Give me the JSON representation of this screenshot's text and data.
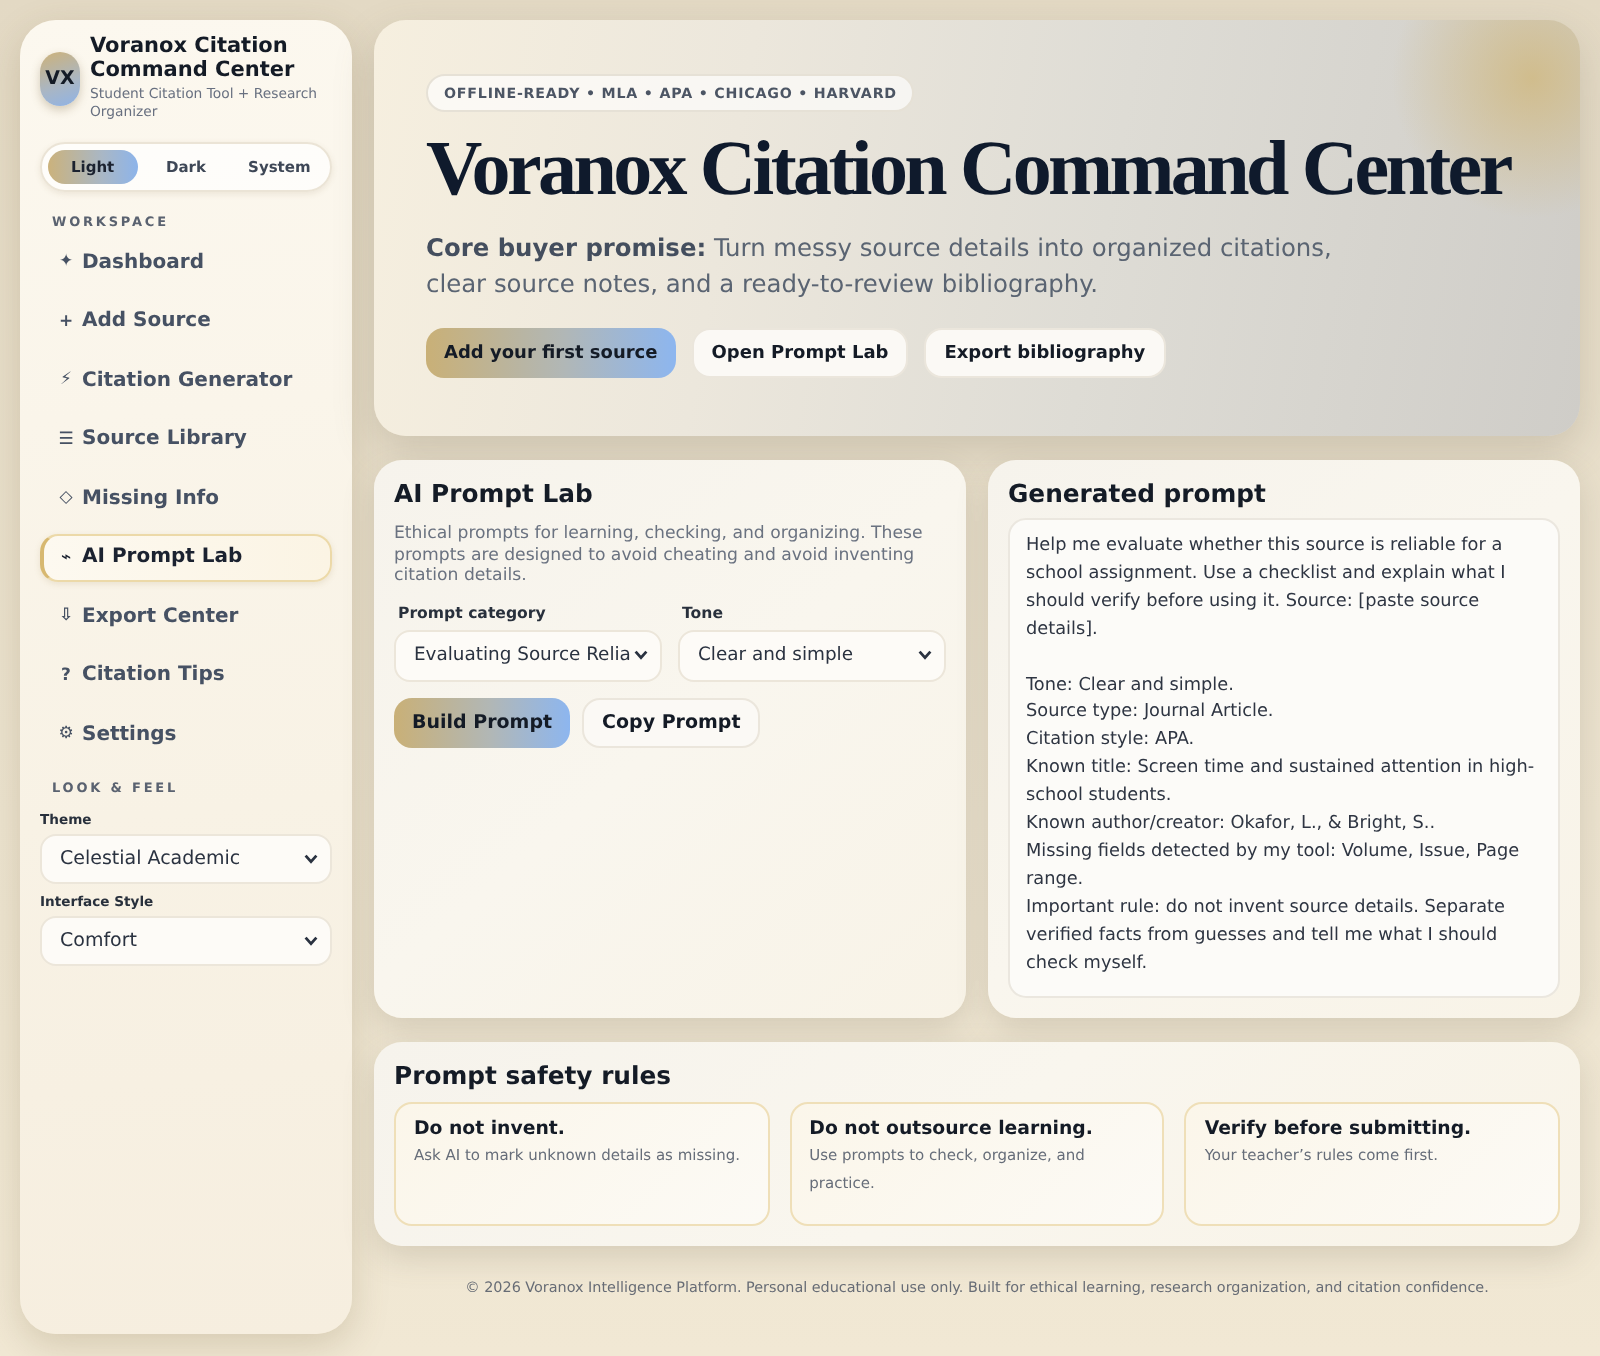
{
  "sidebar": {
    "brand": {
      "logo": "VX",
      "title": "Voranox Citation Command Center",
      "subtitle": "Student Citation Tool + Research Organizer"
    },
    "mode_switch": [
      {
        "label": "Light",
        "selected": true
      },
      {
        "label": "Dark",
        "selected": false
      },
      {
        "label": "System",
        "selected": false
      }
    ],
    "nav_heading": "WORKSPACE",
    "nav_items": [
      {
        "icon": "✦",
        "label": "Dashboard",
        "selected": false
      },
      {
        "icon": "+",
        "label": "Add Source",
        "selected": false
      },
      {
        "icon": "⚡",
        "label": "Citation Generator",
        "selected": false
      },
      {
        "icon": "☰",
        "label": "Source Library",
        "selected": false
      },
      {
        "icon": "◇",
        "label": "Missing Info",
        "selected": false
      },
      {
        "icon": "⌁",
        "label": "AI Prompt Lab",
        "selected": true
      },
      {
        "icon": "⇩",
        "label": "Export Center",
        "selected": false
      },
      {
        "icon": "?",
        "label": "Citation Tips",
        "selected": false
      },
      {
        "icon": "⚙",
        "label": "Settings",
        "selected": false
      }
    ],
    "look_heading": "LOOK & FEEL",
    "fields": [
      {
        "label": "Theme",
        "value": "Celestial Academic"
      },
      {
        "label": "Interface Style",
        "value": "Comfort"
      }
    ]
  },
  "hero": {
    "badge": "OFFLINE-READY • MLA • APA • CHICAGO • HARVARD",
    "title": "Voranox Citation Command Center",
    "promise": "**Core buyer promise:** Turn messy source details into organized citations, clear source notes, and a ready-to-review bibliography.",
    "buttons": [
      {
        "label": "Add your first source",
        "kind": "primary"
      },
      {
        "label": "Open Prompt Lab",
        "kind": "secondary"
      },
      {
        "label": "Export bibliography",
        "kind": "secondary"
      }
    ]
  },
  "prompt_lab": {
    "title": "AI Prompt Lab",
    "description": "Ethical prompts for learning, checking, and organizing. These prompts are designed to avoid cheating and avoid inventing citation details.",
    "fields": [
      {
        "label": "Prompt category",
        "value": "Evaluating Source Relia"
      },
      {
        "label": "Tone",
        "value": "Clear and simple"
      }
    ],
    "buttons": [
      {
        "label": "Build Prompt",
        "kind": "primary"
      },
      {
        "label": "Copy Prompt",
        "kind": "secondary"
      }
    ]
  },
  "generated_prompt": {
    "title": "Generated prompt",
    "text": "Help me evaluate whether this source is reliable for a school assignment. Use a checklist and explain what I should verify before using it. Source: [paste source details].\n\nTone: Clear and simple.\nSource type: Journal Article.\nCitation style: APA.\nKnown title: Screen time and sustained attention in high-school students.\nKnown author/creator: Okafor, L., & Bright, S..\nMissing fields detected by my tool: Volume, Issue, Page range.\nImportant rule: do not invent source details. Separate verified facts from guesses and tell me what I should check myself."
  },
  "safety_rules": {
    "title": "Prompt safety rules",
    "rules": [
      {
        "title": "Do not invent.",
        "text": "Ask AI to mark unknown details as missing."
      },
      {
        "title": "Do not outsource learning.",
        "text": "Use prompts to check, organize, and practice."
      },
      {
        "title": "Verify before submitting.",
        "text": "Your teacher’s rules come first."
      }
    ]
  },
  "footer": "© 2026 Voranox Intelligence Platform. Personal educational use only. Built for ethical learning, research organization, and citation confidence."
}
